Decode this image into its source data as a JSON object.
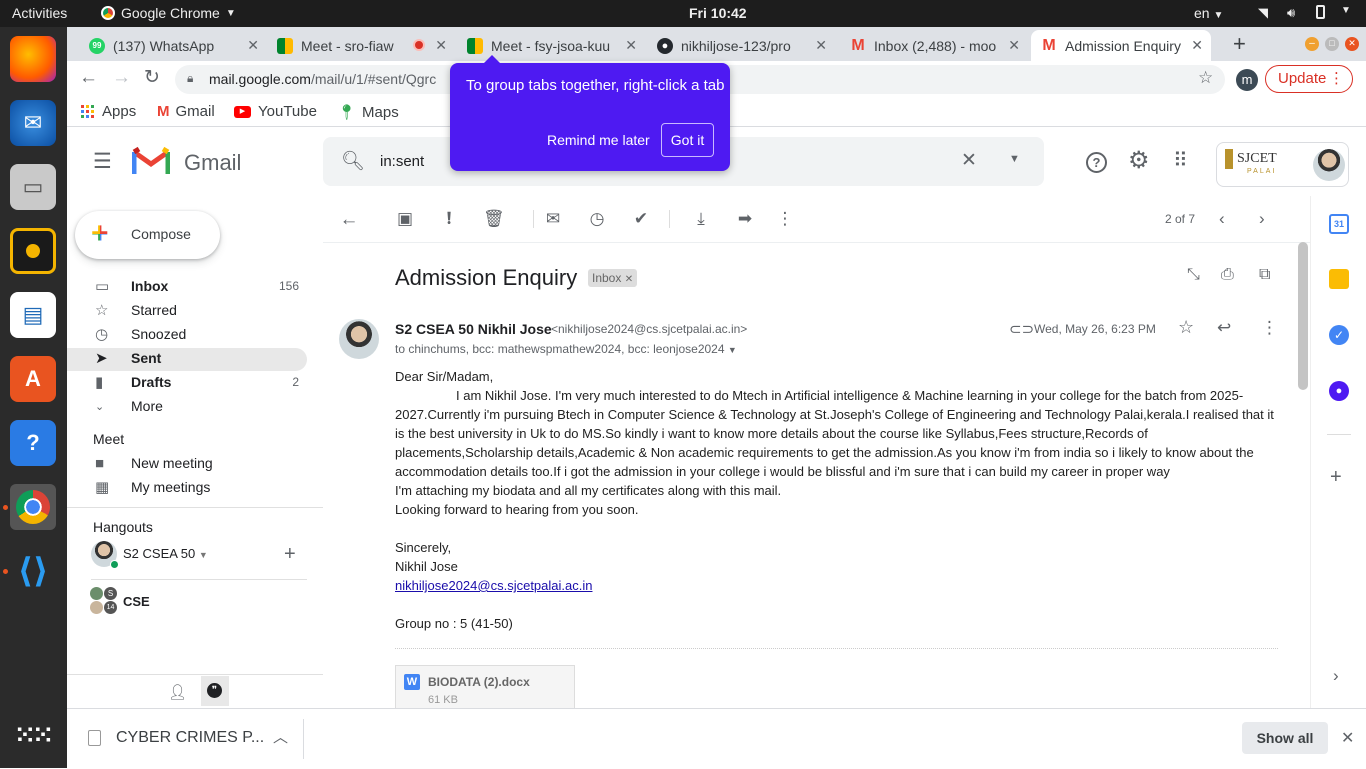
{
  "os": {
    "activities": "Activities",
    "app_name": "Google Chrome",
    "clock": "Fri 10:42",
    "language": "en"
  },
  "tabs": [
    {
      "title": "(137) WhatsApp",
      "icon": "whatsapp-icon"
    },
    {
      "title": "Meet - sro-fiaw",
      "icon": "meet-icon"
    },
    {
      "title": "Meet - fsy-jsoa-kuu",
      "icon": "meet-icon"
    },
    {
      "title": "nikhiljose-123/pro",
      "icon": "github-icon"
    },
    {
      "title": "Inbox (2,488) - moo",
      "icon": "gmail-icon"
    },
    {
      "title": "Admission Enquiry",
      "icon": "gmail-icon"
    }
  ],
  "url": {
    "host": "mail.google.com",
    "path": "/mail/u/1/#sent/Qgrc"
  },
  "profile_initial": "m",
  "update_label": "Update",
  "bookmarks": [
    "Apps",
    "Gmail",
    "YouTube",
    "Maps"
  ],
  "popup": {
    "text": "To group tabs together, right-click a tab",
    "remind": "Remind me later",
    "got_it": "Got it"
  },
  "gmail": {
    "brand": "Gmail",
    "search_value": "in:sent",
    "org_name": "SJCET",
    "org_sub": "PALAI",
    "compose": "Compose",
    "nav": [
      {
        "label": "Inbox",
        "count": "156"
      },
      {
        "label": "Starred",
        "count": ""
      },
      {
        "label": "Snoozed",
        "count": ""
      },
      {
        "label": "Sent",
        "count": ""
      },
      {
        "label": "Drafts",
        "count": "2"
      },
      {
        "label": "More",
        "count": ""
      }
    ],
    "meet_title": "Meet",
    "meet_items": [
      "New meeting",
      "My meetings"
    ],
    "hangouts_title": "Hangouts",
    "hangouts_user": "S2 CSEA 50",
    "group_name": "CSE",
    "group_badges": [
      "S",
      "14"
    ],
    "pager": "2 of 7",
    "subject": "Admission Enquiry",
    "label_chip": "Inbox",
    "sender_name": "S2 CSEA 50 Nikhil Jose",
    "sender_email": "<nikhiljose2024@cs.sjcetpalai.ac.in>",
    "date": "Wed, May 26, 6:23 PM",
    "recipients": "to chinchums, bcc: mathewspmathew2024, bcc: leonjose2024",
    "body": {
      "greeting": "Dear Sir/Madam,",
      "para1_line1": "I am Nikhil Jose. I'm very much interested to do Mtech in Artificial intelligence & Machine learning in your college for the batch from 2025-",
      "para1_line2": "2027.Currently i'm pursuing Btech in Computer Science & Technology at St.Joseph's College of Engineering and Technology Palai,kerala.I realised that it",
      "para1_line3": "is the best university in Uk to do MS.So kindly i want to know more details about the course like Syllabus,Fees structure,Records of",
      "para1_line4": "placements,Scholarship details,Academic & Non academic requirements to get the admission.As you know i'm from india so i likely to know about the",
      "para1_line5": "accommodation details too.If i got the admission in your college i would be blissful and i'm sure that i can build my career in proper way",
      "line_attach": "I'm attaching my biodata and all my certificates along with this mail.",
      "line_forward": "Looking forward to hearing from you soon.",
      "sincerely": "Sincerely,",
      "name": "Nikhil Jose",
      "email_link": "nikhiljose2024@cs.sjcetpalai.ac.in",
      "group": "Group no : 5 (41-50)"
    },
    "attachment": {
      "name": "BIODATA (2).docx",
      "size": "61 KB"
    }
  },
  "download": {
    "file": "CYBER CRIMES P...",
    "show_all": "Show all"
  },
  "colors": {
    "popup": "#4e1af2",
    "sent_highlight": "#e8e8e8",
    "update": "#d93025"
  }
}
